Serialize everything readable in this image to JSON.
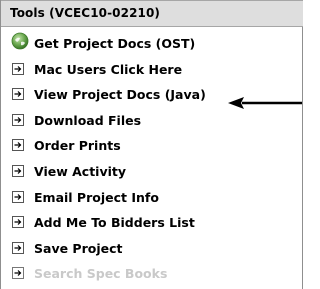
{
  "header": {
    "title": "Tools   (VCEC10-02210)"
  },
  "menu": {
    "items": [
      {
        "label": "Get Project Docs (OST)",
        "icon": "globe-icon",
        "enabled": true
      },
      {
        "label": "Mac Users Click Here",
        "icon": "arrow-box-icon",
        "enabled": true
      },
      {
        "label": "View Project Docs (Java)",
        "icon": "arrow-box-icon",
        "enabled": true
      },
      {
        "label": "Download Files",
        "icon": "arrow-box-icon",
        "enabled": true
      },
      {
        "label": "Order Prints",
        "icon": "arrow-box-icon",
        "enabled": true
      },
      {
        "label": "View Activity",
        "icon": "arrow-box-icon",
        "enabled": true
      },
      {
        "label": "Email Project Info",
        "icon": "arrow-box-icon",
        "enabled": true
      },
      {
        "label": "Add Me To Bidders List",
        "icon": "arrow-box-icon",
        "enabled": true
      },
      {
        "label": "Save Project",
        "icon": "arrow-box-icon",
        "enabled": true
      },
      {
        "label": "Search Spec Books",
        "icon": "arrow-box-icon",
        "enabled": false
      }
    ]
  },
  "annotation": {
    "icon": "pointer-arrow-icon",
    "points_to": "View Project Docs (Java)"
  },
  "colors": {
    "header_bg": "#dedede",
    "border": "#8f8f8f",
    "text": "#000000",
    "disabled_text": "#c9c9c9",
    "globe": "#6aa84f"
  }
}
